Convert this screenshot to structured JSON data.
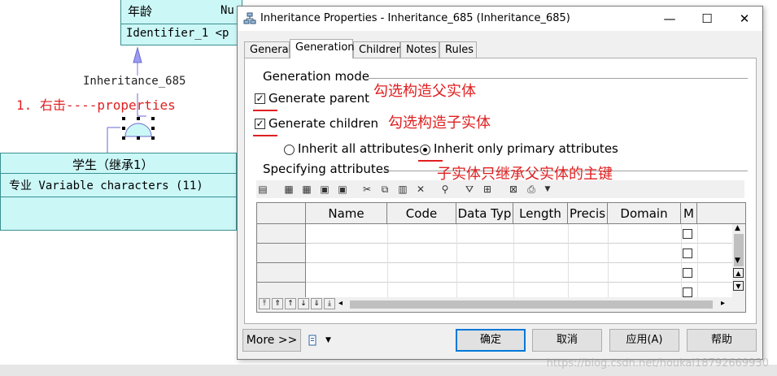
{
  "diagram": {
    "parent_entity": {
      "row_top": "年龄",
      "row_top_extra": "Nu",
      "identifier": "Identifier_1 <p"
    },
    "inheritance_label": "Inheritance_685",
    "annotation_step1": "1. 右击----properties",
    "child_entity": {
      "name": "学生（继承1）",
      "attribute": "专业  Variable characters (11)"
    }
  },
  "dialog": {
    "title": "Inheritance Properties - Inheritance_685 (Inheritance_685)",
    "window_buttons": {
      "minimize": "—",
      "maximize": "☐",
      "close": "✕"
    },
    "tabs": [
      "General",
      "Generation",
      "Children",
      "Notes",
      "Rules"
    ],
    "active_tab": "Generation",
    "generation_mode": {
      "group_label": "Generation mode",
      "generate_parent": {
        "label": "Generate parent",
        "checked": true
      },
      "generate_children": {
        "label": "Generate children",
        "checked": true
      },
      "inherit_all": {
        "label": "Inherit all attributes",
        "selected": false
      },
      "inherit_primary": {
        "label": "Inherit only primary attributes",
        "selected": true
      }
    },
    "annotations": {
      "parent_note": "勾选构造父实体",
      "children_note": "勾选构造子实体",
      "primary_note": "子实体只继承父实体的主键"
    },
    "specifying_attributes": {
      "group_label": "Specifying attributes",
      "columns": [
        "Name",
        "Code",
        "Data Typ",
        "Length",
        "Precis",
        "Domain",
        "M"
      ]
    },
    "buttons": {
      "more": "More >>",
      "ok": "确定",
      "cancel": "取消",
      "apply": "应用(A)",
      "help": "帮助"
    }
  },
  "watermark": "https://blog.csdn.net/houkai18792669930",
  "colors": {
    "accent": "#0078d7",
    "annotation": "#e02020",
    "entity_fill": "#ccf7f7"
  }
}
